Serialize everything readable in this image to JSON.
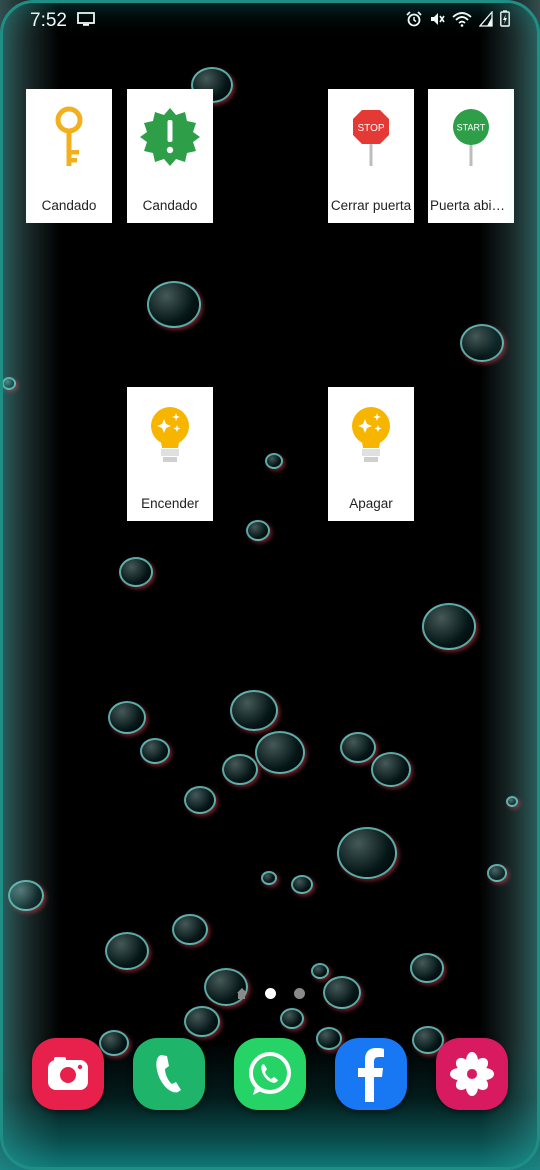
{
  "status_bar": {
    "time": "7:52",
    "icons": [
      "screen-cast-icon",
      "alarm-icon",
      "mute-icon",
      "wifi-icon",
      "signal-icon",
      "battery-charging-icon"
    ]
  },
  "widgets": [
    {
      "label": "Candado",
      "icon": "key-icon",
      "color": "#F2B01E"
    },
    {
      "label": "Candado",
      "icon": "alert-badge-icon",
      "color": "#2E9E48"
    },
    {
      "label": "Cerrar puerta",
      "icon": "stop-sign-icon",
      "color": "#E53935",
      "sign_text": "STOP"
    },
    {
      "label": "Puerta abier…",
      "icon": "start-sign-icon",
      "color": "#2E9E48",
      "sign_text": "START"
    },
    {
      "label": "Encender",
      "icon": "lightbulb-icon",
      "color": "#F7B500"
    },
    {
      "label": "Apagar",
      "icon": "lightbulb-icon",
      "color": "#F7B500"
    }
  ],
  "page_indicator": {
    "pages": 2,
    "active": 1,
    "has_home": true
  },
  "dock": [
    {
      "name": "camera-app",
      "color": "#E8214C"
    },
    {
      "name": "phone-app",
      "color": "#1EB56A"
    },
    {
      "name": "whatsapp-app",
      "color": "#25D366"
    },
    {
      "name": "facebook-app",
      "color": "#1877F2"
    },
    {
      "name": "gallery-app",
      "color": "#D81B60"
    }
  ]
}
